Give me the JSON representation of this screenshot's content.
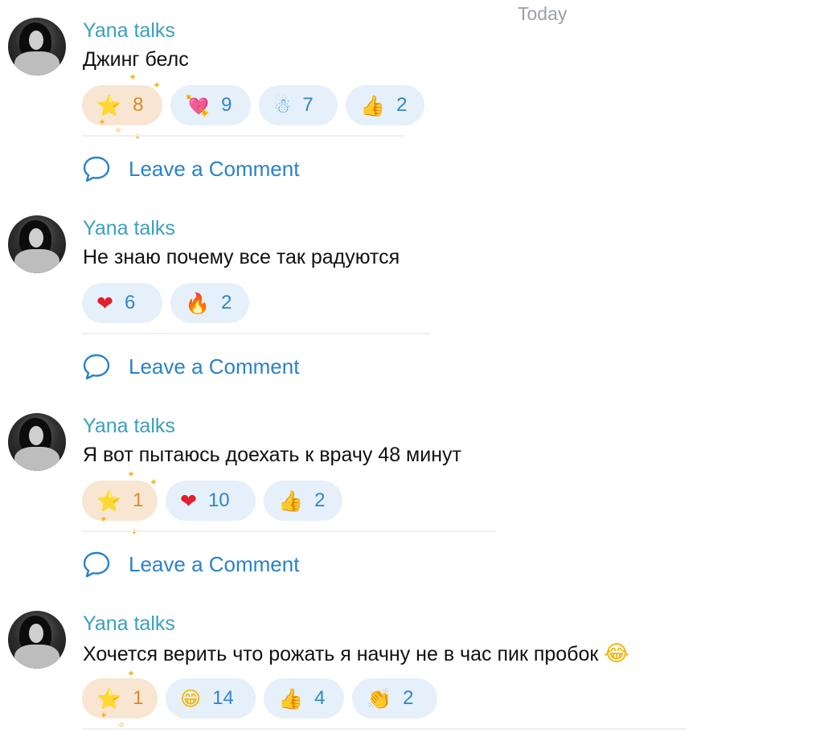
{
  "date_label": "Today",
  "comment_label": "Leave a Comment",
  "posts": [
    {
      "author": "Yana talks",
      "text": "Джинг белс",
      "reactions": [
        {
          "icon": "star-icon",
          "glyph": "⭐",
          "count": "8",
          "starred": true
        },
        {
          "icon": "cupid-heart-icon",
          "glyph": "💘",
          "count": "9"
        },
        {
          "icon": "snowman-icon",
          "glyph": "☃",
          "count": "7"
        },
        {
          "icon": "thumbs-up-icon",
          "glyph": "👍",
          "count": "2"
        }
      ]
    },
    {
      "author": "Yana talks",
      "text": "Не знаю почему все так радуются",
      "reactions": [
        {
          "icon": "heart-icon",
          "glyph": "❤",
          "count": "6"
        },
        {
          "icon": "fire-icon",
          "glyph": "🔥",
          "count": "2"
        }
      ]
    },
    {
      "author": "Yana talks",
      "text": "Я вот пытаюсь доехать к врачу 48 минут",
      "reactions": [
        {
          "icon": "star-icon",
          "glyph": "⭐",
          "count": "1",
          "starred": true
        },
        {
          "icon": "heart-icon",
          "glyph": "❤",
          "count": "10"
        },
        {
          "icon": "thumbs-up-icon",
          "glyph": "👍",
          "count": "2"
        }
      ]
    },
    {
      "author": "Yana talks",
      "text": "Хочется верить что рожать я начну не в час пик пробок",
      "text_emoji": "😂",
      "reactions": [
        {
          "icon": "star-icon",
          "glyph": "⭐",
          "count": "1",
          "starred": true
        },
        {
          "icon": "grinning-face-icon",
          "glyph": "😁",
          "count": "14"
        },
        {
          "icon": "thumbs-up-icon",
          "glyph": "👍",
          "count": "4"
        },
        {
          "icon": "clapping-hands-icon",
          "glyph": "👏",
          "count": "2"
        }
      ]
    }
  ],
  "colors": {
    "author": "#3a9fbf",
    "link": "#2a82c8",
    "reaction_bg": "#e6f0fa",
    "starred_bg": "#f8e6d3",
    "count": "#2f86c8",
    "starred_count": "#d88a2e"
  }
}
